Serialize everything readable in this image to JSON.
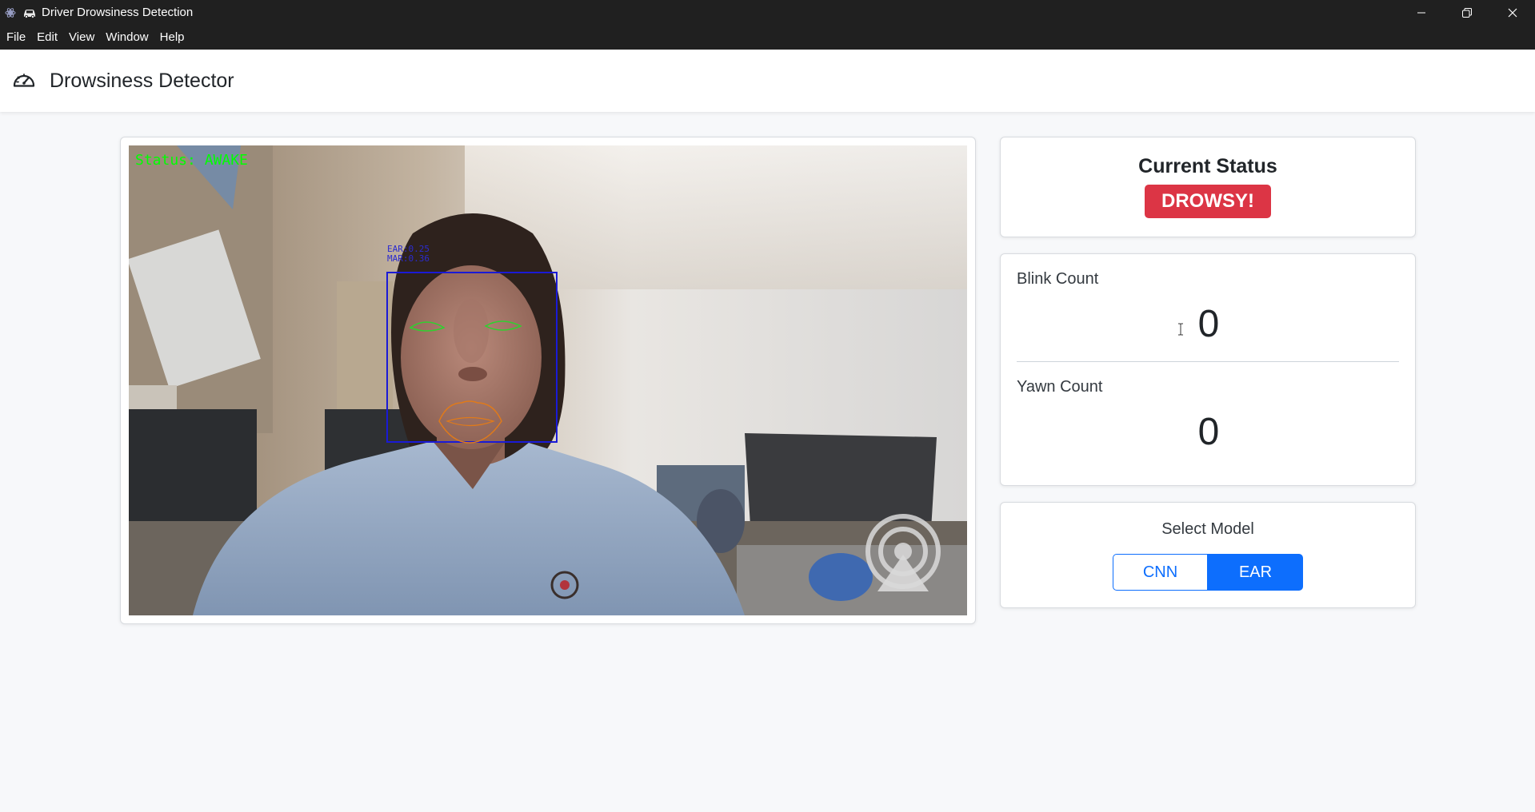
{
  "window": {
    "title": "Driver Drowsiness Detection",
    "controls": [
      "minimize-icon",
      "restore-icon",
      "close-icon"
    ]
  },
  "menu": {
    "items": [
      "File",
      "Edit",
      "View",
      "Window",
      "Help"
    ]
  },
  "header": {
    "brand": "Drowsiness Detector",
    "icon": "speedometer-icon"
  },
  "video": {
    "overlay_status": "Status: AWAKE",
    "ear": "EAR:0.25",
    "mar": "MAR:0.36"
  },
  "status": {
    "title": "Current Status",
    "badge": "DROWSY!"
  },
  "counts": {
    "blink_label": "Blink Count",
    "blink_value": "0",
    "yawn_label": "Yawn Count",
    "yawn_value": "0"
  },
  "model": {
    "title": "Select Model",
    "options": [
      "CNN",
      "EAR"
    ],
    "selected": "EAR"
  },
  "colors": {
    "danger": "#dc3545",
    "primary": "#0d6efd",
    "overlay_text": "#00ff00",
    "face_box": "#1a1ad6"
  }
}
